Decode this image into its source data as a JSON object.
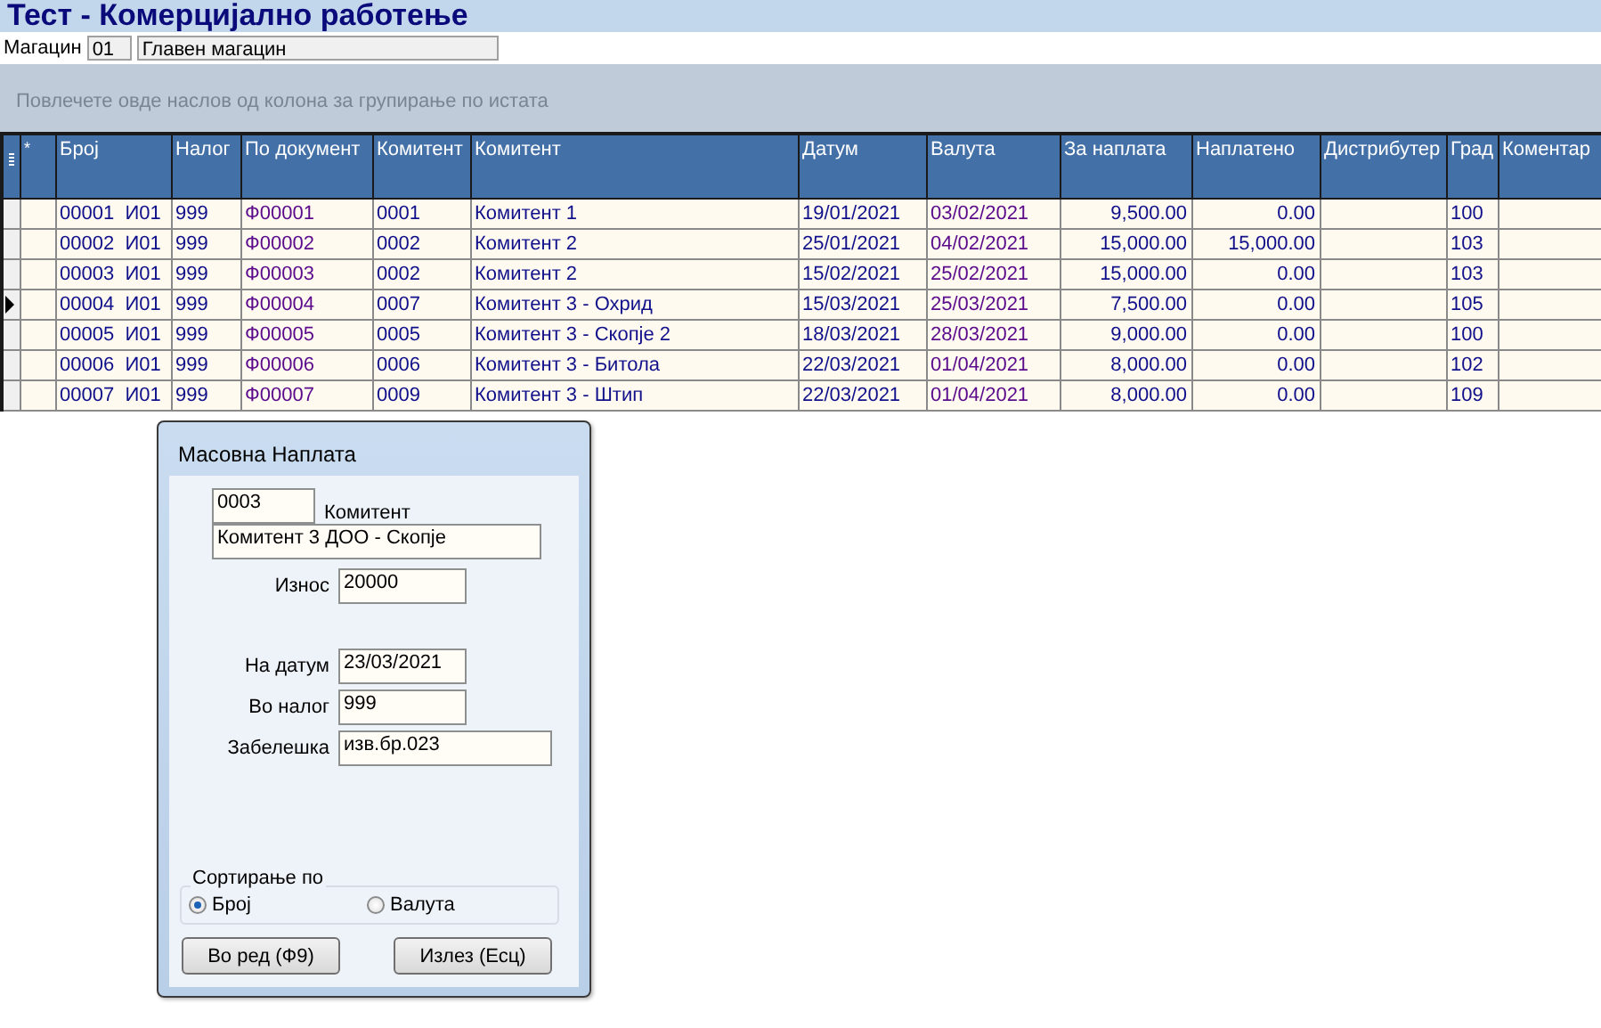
{
  "window": {
    "title": "Тест - Комерцијално работење"
  },
  "warehouse": {
    "label": "Магацин",
    "code": "01",
    "name": "Главен магацин"
  },
  "group_panel": {
    "hint": "Повлечете овде наслов од колона за групирање по истата"
  },
  "table": {
    "corner": "*",
    "columns": [
      "Број",
      "Налог",
      "По документ",
      "Комитент",
      "Комитент",
      "Датум",
      "Валута",
      "За наплата",
      "Наплатено",
      "Дистрибутер",
      "Град",
      "Коментар"
    ],
    "rows": [
      {
        "selected": false,
        "cells": [
          "00001  И01",
          "999",
          "Ф00001",
          "0001",
          "Комитент 1",
          "19/01/2021",
          "03/02/2021",
          "9,500.00",
          "0.00",
          "",
          "100",
          ""
        ]
      },
      {
        "selected": false,
        "cells": [
          "00002  И01",
          "999",
          "Ф00002",
          "0002",
          "Комитент 2",
          "25/01/2021",
          "04/02/2021",
          "15,000.00",
          "15,000.00",
          "",
          "103",
          ""
        ]
      },
      {
        "selected": false,
        "cells": [
          "00003  И01",
          "999",
          "Ф00003",
          "0002",
          "Комитент 2",
          "15/02/2021",
          "25/02/2021",
          "15,000.00",
          "0.00",
          "",
          "103",
          ""
        ]
      },
      {
        "selected": true,
        "cells": [
          "00004  И01",
          "999",
          "Ф00004",
          "0007",
          "Комитент 3 - Охрид",
          "15/03/2021",
          "25/03/2021",
          "7,500.00",
          "0.00",
          "",
          "105",
          ""
        ]
      },
      {
        "selected": false,
        "cells": [
          "00005  И01",
          "999",
          "Ф00005",
          "0005",
          "Комитент 3 - Скопје 2",
          "18/03/2021",
          "28/03/2021",
          "9,000.00",
          "0.00",
          "",
          "100",
          ""
        ]
      },
      {
        "selected": false,
        "cells": [
          "00006  И01",
          "999",
          "Ф00006",
          "0006",
          "Комитент 3 - Битола",
          "22/03/2021",
          "01/04/2021",
          "8,000.00",
          "0.00",
          "",
          "102",
          ""
        ]
      },
      {
        "selected": false,
        "cells": [
          "00007  И01",
          "999",
          "Ф00007",
          "0009",
          "Комитент 3 - Штип",
          "22/03/2021",
          "01/04/2021",
          "8,000.00",
          "0.00",
          "",
          "109",
          ""
        ]
      }
    ]
  },
  "dialog": {
    "title": "Масовна Наплата",
    "client_code": "0003",
    "client_label": "Комитент",
    "client_name": "Комитент 3 ДОО - Скопје",
    "fields": [
      {
        "label": "Износ",
        "value": "20000"
      },
      {
        "label": "На датум",
        "value": "23/03/2021"
      },
      {
        "label": "Во налог",
        "value": "999"
      },
      {
        "label": "Забелешка",
        "value": "изв.бр.023"
      }
    ],
    "sort": {
      "label": "Сортирање по",
      "options": [
        {
          "label": "Број",
          "selected": true
        },
        {
          "label": "Валута",
          "selected": false
        }
      ]
    },
    "buttons": [
      "Во ред (Ф9)",
      "Излез (Есц)"
    ]
  }
}
